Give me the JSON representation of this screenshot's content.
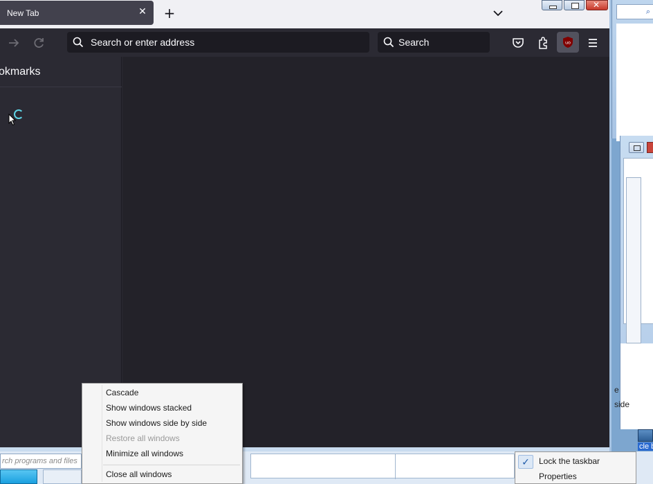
{
  "firefox": {
    "tab": {
      "title": "New Tab"
    },
    "urlbar": {
      "placeholder": "Search or enter address"
    },
    "searchbar": {
      "placeholder": "Search"
    },
    "ublock_label": "uo",
    "sidebar": {
      "title": "okmarks"
    },
    "icons": [
      "forward-arrow-icon",
      "reload-icon",
      "search-icon",
      "pocket-icon",
      "extensions-icon",
      "ublock-icon",
      "menu-icon",
      "close-icon",
      "plus-icon",
      "chevron-down-icon",
      "loading-spinner-icon",
      "mouse-cursor-icon"
    ]
  },
  "taskbar": {
    "start_search_placeholder": "rch programs and files"
  },
  "context_menu": {
    "items": [
      {
        "label": "Cascade",
        "enabled": true
      },
      {
        "label": "Show windows stacked",
        "enabled": true
      },
      {
        "label": "Show windows side by side",
        "enabled": true
      },
      {
        "label": "Restore all windows",
        "enabled": false
      },
      {
        "label": "Minimize all windows",
        "enabled": true
      },
      {
        "label": "Close all windows",
        "enabled": true
      }
    ]
  },
  "taskbar_menu": {
    "items": [
      {
        "label": "Lock the taskbar",
        "checked": true
      },
      {
        "label": "Properties",
        "checked": false
      }
    ]
  },
  "background": {
    "window_text_e": "e",
    "window_text_side": "side",
    "desktop_icon_label": "cle b"
  },
  "colors": {
    "firefox_dark": "#2b2a33",
    "urlbar_bg": "#1c1b22",
    "ublock_red": "#800000",
    "spinner": "#5fd4e6"
  }
}
